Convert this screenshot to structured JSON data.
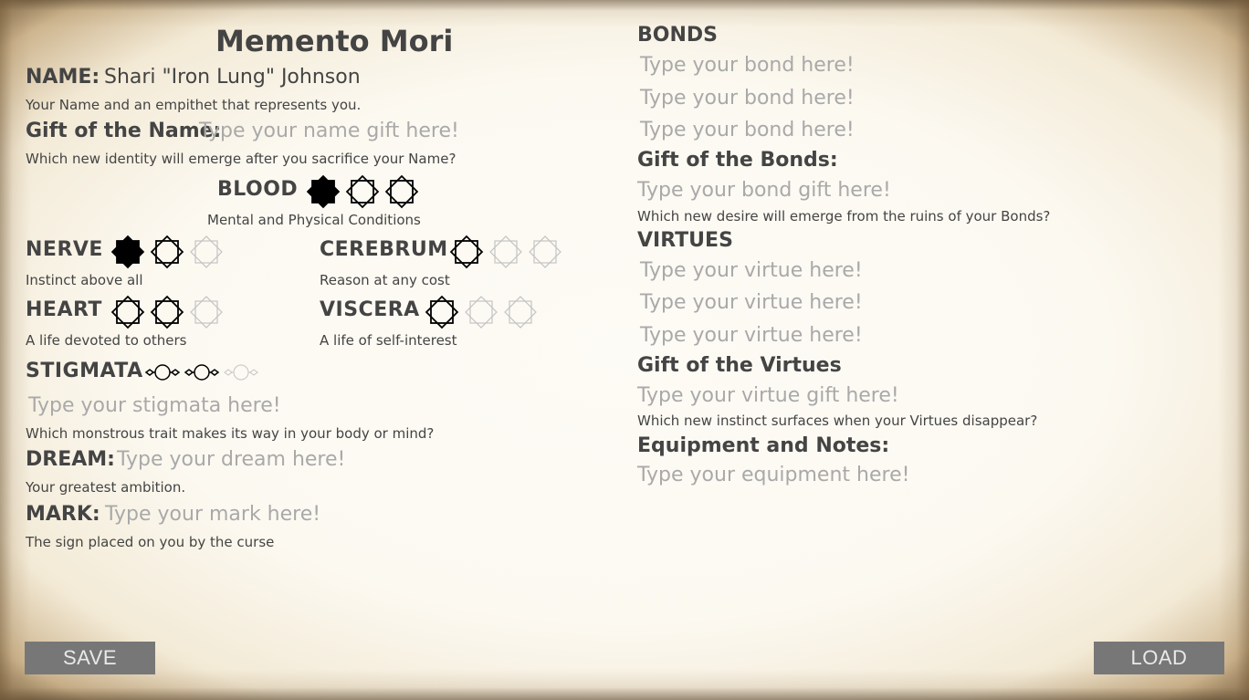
{
  "title": "Memento Mori",
  "name": {
    "label": "NAME:",
    "value": "Shari \"Iron Lung\" Johnson",
    "hint": "Your Name and an empithet that represents you."
  },
  "gift_name": {
    "label": "Gift of the Name:",
    "placeholder": "Type your name gift here!",
    "hint": "Which new identity will emerge after you sacrifice your Name?"
  },
  "blood": {
    "label": "BLOOD",
    "hint": "Mental and Physical Conditions",
    "level": 1,
    "max": 3
  },
  "stats": {
    "nerve": {
      "label": "NERVE",
      "hint": "Instinct above all",
      "filled": 1,
      "marked": 1,
      "max": 3
    },
    "cerebrum": {
      "label": "CEREBRUM",
      "hint": "Reason at any cost",
      "filled": 0,
      "marked": 1,
      "max": 3
    },
    "heart": {
      "label": "HEART",
      "hint": "A life devoted to others",
      "filled": 0,
      "marked": 2,
      "max": 3
    },
    "viscera": {
      "label": "VISCERA",
      "hint": "A life of self-interest",
      "filled": 0,
      "marked": 1,
      "max": 3
    }
  },
  "stigmata": {
    "label": "STIGMATA",
    "marked": 2,
    "max": 3,
    "placeholder": "Type your stigmata here!",
    "hint": "Which monstrous trait makes its way in your body or mind?"
  },
  "dream": {
    "label": "DREAM:",
    "placeholder": "Type your dream here!",
    "hint": "Your greatest ambition."
  },
  "mark": {
    "label": "MARK:",
    "placeholder": "Type your mark here!",
    "hint": "The sign placed on you by the curse"
  },
  "bonds": {
    "label": "BONDS",
    "placeholders": [
      "Type your bond here!",
      "Type your bond here!",
      "Type your bond here!"
    ]
  },
  "gift_bonds": {
    "label": "Gift of the Bonds:",
    "placeholder": "Type your bond gift here!",
    "hint": "Which new desire will emerge from the ruins of your Bonds?"
  },
  "virtues": {
    "label": "VIRTUES",
    "placeholders": [
      "Type your virtue here!",
      "Type your virtue here!",
      "Type your virtue here!"
    ]
  },
  "gift_virtues": {
    "label": "Gift of the Virtues",
    "placeholder": "Type your virtue gift here!",
    "hint": "Which new instinct surfaces when your Virtues disappear?"
  },
  "equipment": {
    "label": "Equipment and Notes:",
    "placeholder": "Type your equipment here!"
  },
  "buttons": {
    "save": "SAVE",
    "load": "LOAD"
  },
  "colors": {
    "button_bg": "#777777",
    "button_text": "#e9e9e9",
    "placeholder": "#a9a9a9",
    "text": "#444444"
  }
}
